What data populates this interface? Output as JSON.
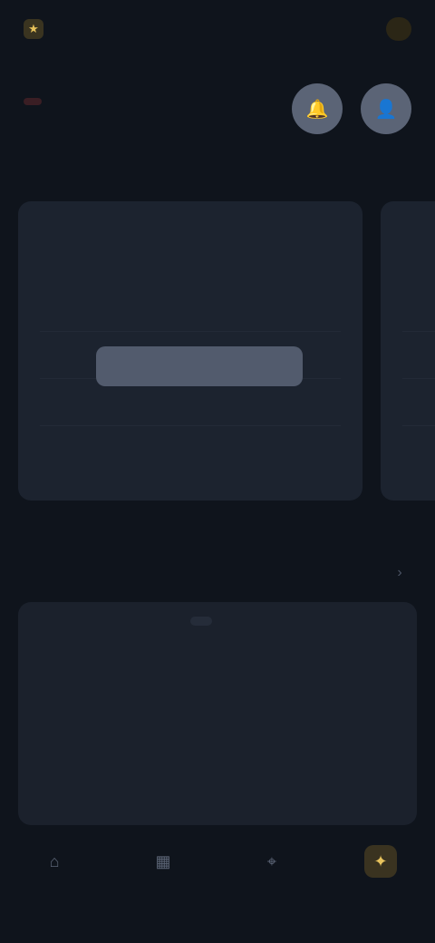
{
  "topbar": {
    "brand_icon": "star-icon",
    "brand_name": "",
    "account": ""
  },
  "hero": {
    "tag": "",
    "title": "",
    "hint": "",
    "button_a_icon": "bell-icon",
    "button_b_icon": "user-icon"
  },
  "cards": [
    {
      "title": "",
      "rows": [
        "",
        "",
        ""
      ],
      "cta": "",
      "stats": [
        "",
        "",
        "",
        ""
      ]
    },
    {
      "title": "",
      "rows": [
        "",
        "",
        ""
      ]
    }
  ],
  "section": {
    "title": "",
    "more_icon": "chevron-right-icon"
  },
  "grid": {
    "top_label": "",
    "items": [
      "",
      "",
      "",
      "",
      "",
      ""
    ]
  },
  "nav": {
    "items": [
      {
        "icon": "home-icon",
        "label": ""
      },
      {
        "icon": "chart-icon",
        "label": ""
      },
      {
        "icon": "pin-icon",
        "label": ""
      },
      {
        "icon": "gift-icon",
        "label": ""
      }
    ],
    "active_index": 3
  },
  "colors": {
    "background": "#0f141c",
    "accent_gold": "#e8c35d",
    "tag_red": "#e0586c"
  }
}
